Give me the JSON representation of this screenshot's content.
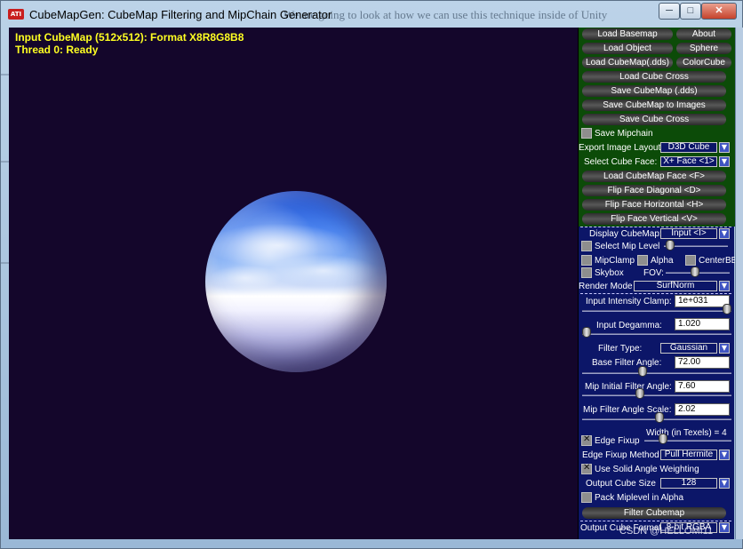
{
  "window": {
    "title": "CubeMapGen: CubeMap Filtering and MipChain Generator",
    "title_background_text": "We are going to look at how we can use this technique inside of Unity",
    "icon_text": "ATI",
    "controls": {
      "minimize": "minimize-icon",
      "maximize": "maximize-icon",
      "close": "close-icon"
    }
  },
  "viewport": {
    "status_line1": "Input CubeMap (512x512): Format X8R8G8B8",
    "status_line2": "Thread 0: Ready",
    "status_color": "#ffff22",
    "background_color": "#14062b"
  },
  "panel": {
    "buttons": {
      "load_basemap": "Load Basemap",
      "about": "About",
      "load_object": "Load Object",
      "sphere": "Sphere",
      "load_cubemap_dds": "Load CubeMap(.dds)",
      "colorcube": "ColorCube",
      "load_cube_cross": "Load Cube Cross",
      "save_cubemap_dds": "Save CubeMap (.dds)",
      "save_cubemap_images": "Save CubeMap to Images",
      "save_cube_cross": "Save Cube Cross",
      "load_cubemap_face": "Load CubeMap Face   <F>",
      "flip_face_diagonal": "Flip Face Diagonal   <D>",
      "flip_face_horizontal": "Flip Face Horizontal   <H>",
      "flip_face_vertical": "Flip Face Vertical   <V>",
      "filter_cubemap": "Filter Cubemap"
    },
    "save_mipchain": {
      "label": "Save Mipchain",
      "checked": false
    },
    "export_layout": {
      "label": "Export Image Layout:",
      "value": "D3D Cube"
    },
    "select_cube_face": {
      "label": "Select Cube Face:",
      "value": "X+ Face <1>"
    },
    "display_cubemap": {
      "label": "Display CubeMap:",
      "value": "Input <I>"
    },
    "select_mip_level": {
      "label": "Select Mip Level",
      "checked": false
    },
    "mipclamp": {
      "label": "MipClamp",
      "checked": false
    },
    "alpha": {
      "label": "Alpha",
      "checked": false
    },
    "centerbb": {
      "label": "CenterBB",
      "checked": false
    },
    "skybox": {
      "label": "Skybox",
      "checked": false
    },
    "fov": {
      "label": "FOV:",
      "level": 0.45
    },
    "render_mode": {
      "label": "Render Mode",
      "value": "SurfNorm"
    },
    "input_intensity_clamp": {
      "label": "Input Intensity Clamp:",
      "value": "1e+031",
      "level": 1.0
    },
    "input_degamma": {
      "label": "Input Degamma:",
      "value": "1.020",
      "level": 0.0
    },
    "filter_type": {
      "label": "Filter Type:",
      "value": "Gaussian"
    },
    "base_filter_angle": {
      "label": "Base Filter Angle:",
      "value": "72.00",
      "level": 0.4
    },
    "mip_initial_filter_angle": {
      "label": "Mip Initial Filter Angle:",
      "value": "7.60",
      "level": 0.38
    },
    "mip_filter_angle_scale": {
      "label": "Mip Filter Angle Scale:",
      "value": "2.02",
      "level": 0.52
    },
    "edge_fixup_width": {
      "label": "Width (in Texels) = 4",
      "level": 0.18
    },
    "edge_fixup": {
      "label": "Edge Fixup",
      "checked": true
    },
    "edge_fixup_method": {
      "label": "Edge Fixup Method",
      "value": "Pull Hermite"
    },
    "use_solid_angle": {
      "label": "Use Solid Angle Weighting",
      "checked": true
    },
    "output_cube_size": {
      "label": "Output Cube Size",
      "value": "128"
    },
    "pack_miplevel_alpha": {
      "label": "Pack Miplevel in Alpha",
      "checked": false
    },
    "output_cube_format": {
      "label": "Output Cube Format",
      "value": "8-bit RGBA"
    }
  },
  "watermark": "CSDN @HELLOMI11"
}
